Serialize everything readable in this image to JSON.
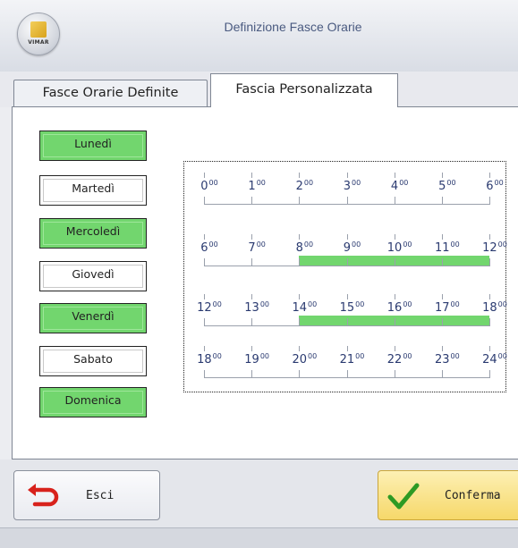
{
  "window": {
    "title": "Definizione Fasce Orarie",
    "logo_text": "VIMAR"
  },
  "tabs": [
    {
      "label": "Fasce Orarie Definite",
      "active": false
    },
    {
      "label": "Fascia Personalizzata",
      "active": true
    }
  ],
  "days": [
    {
      "label": "Lunedì",
      "selected": true
    },
    {
      "label": "Martedì",
      "selected": false
    },
    {
      "label": "Mercoledì",
      "selected": true
    },
    {
      "label": "Giovedì",
      "selected": false
    },
    {
      "label": "Venerdì",
      "selected": true
    },
    {
      "label": "Sabato",
      "selected": false
    },
    {
      "label": "Domenica",
      "selected": true
    }
  ],
  "schedule": {
    "rows": [
      {
        "hours": [
          "0",
          "1",
          "2",
          "3",
          "4",
          "5",
          "6"
        ],
        "active_from": null,
        "active_to": null
      },
      {
        "hours": [
          "6",
          "7",
          "8",
          "9",
          "10",
          "11",
          "12"
        ],
        "active_from": 8,
        "active_to": 12
      },
      {
        "hours": [
          "12",
          "13",
          "14",
          "15",
          "16",
          "17",
          "18"
        ],
        "active_from": 14,
        "active_to": 18
      },
      {
        "hours": [
          "18",
          "19",
          "20",
          "21",
          "22",
          "23",
          "24"
        ],
        "active_from": null,
        "active_to": null
      }
    ],
    "minutes_suffix": "00",
    "active_color": "#72d66e"
  },
  "buttons": {
    "exit": {
      "label": "Esci",
      "icon": "undo-arrow-icon"
    },
    "confirm": {
      "label": "Conferma",
      "icon": "checkmark-icon"
    }
  }
}
